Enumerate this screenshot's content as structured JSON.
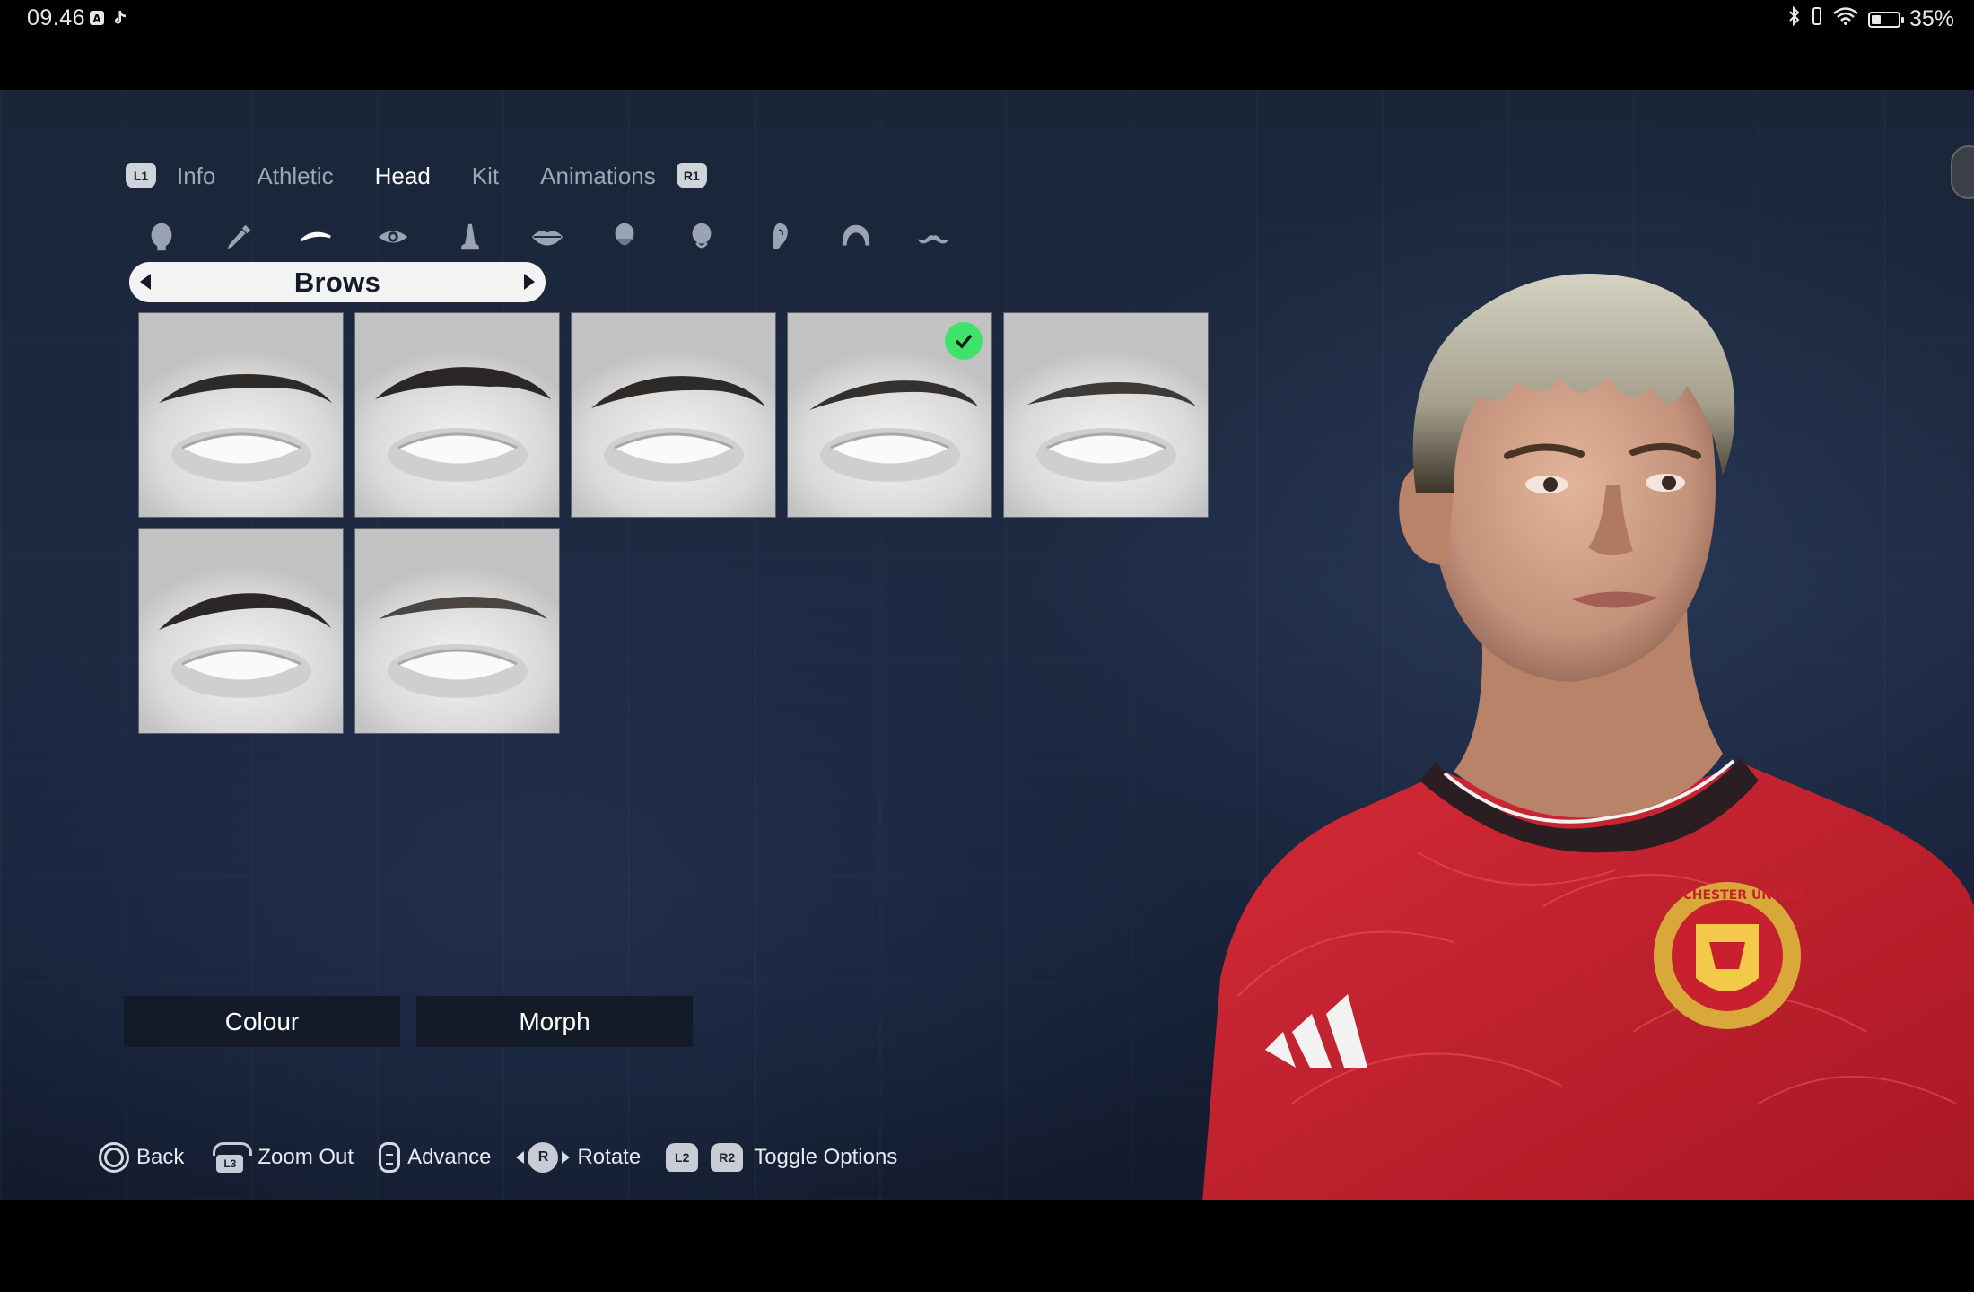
{
  "status_bar": {
    "time": "09.46",
    "battery_text": "35%",
    "battery_level": 0.35,
    "notification_icons": [
      "a-icon",
      "tiktok-icon"
    ],
    "system_icons": [
      "bluetooth-icon",
      "vibrate-icon",
      "wifi-icon",
      "battery-icon"
    ]
  },
  "tabs": {
    "left_shoulder": "L1",
    "right_shoulder": "R1",
    "items": [
      {
        "label": "Info",
        "active": false
      },
      {
        "label": "Athletic",
        "active": false
      },
      {
        "label": "Head",
        "active": true
      },
      {
        "label": "Kit",
        "active": false
      },
      {
        "label": "Animations",
        "active": false
      }
    ]
  },
  "categories": {
    "icons": [
      "head-icon",
      "skin-tone-dropper-icon",
      "brows-icon",
      "eye-icon",
      "nose-icon",
      "lips-icon",
      "jaw-icon",
      "chin-icon",
      "ear-icon",
      "hair-icon",
      "moustache-icon"
    ],
    "active_index": 2
  },
  "selector": {
    "label": "Brows"
  },
  "brow_options": {
    "count": 7,
    "selected_index": 3,
    "style_names": [
      "brow-style-1",
      "brow-style-2",
      "brow-style-3",
      "brow-style-4",
      "brow-style-5",
      "brow-style-6",
      "brow-style-7"
    ]
  },
  "options": {
    "colour_label": "Colour",
    "morph_label": "Morph"
  },
  "hints": {
    "back": "Back",
    "zoom_out": "Zoom Out",
    "advance": "Advance",
    "rotate": "Rotate",
    "toggle_options": "Toggle Options",
    "l3": "L3",
    "r": "R",
    "l2": "L2",
    "r2": "R2"
  },
  "player": {
    "kit_color": "#c8202e",
    "badge_text": "MANCHESTER UNITED"
  },
  "colors": {
    "accent_check": "#3fe36c",
    "selector_bg": "#f3f3f3",
    "active_tab": "#ffffff",
    "inactive_tab": "#9ea7b8"
  }
}
